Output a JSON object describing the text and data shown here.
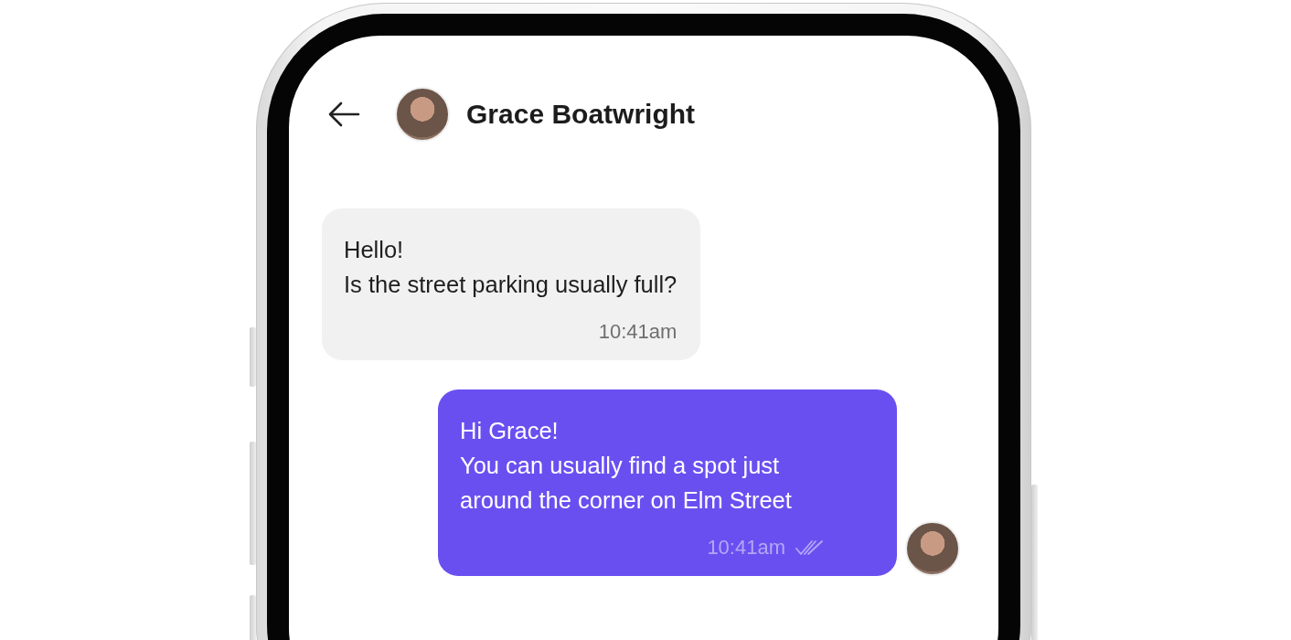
{
  "header": {
    "contact_name": "Grace Boatwright"
  },
  "messages": [
    {
      "kind": "incoming",
      "text": "Hello!\nIs the street parking usually full?",
      "time": "10:41am",
      "read": false,
      "show_avatar": false
    },
    {
      "kind": "outgoing",
      "text": "Hi Grace!\nYou can usually find a spot just around the corner on Elm Street",
      "time": "10:41am",
      "read": true,
      "show_avatar": true
    }
  ]
}
